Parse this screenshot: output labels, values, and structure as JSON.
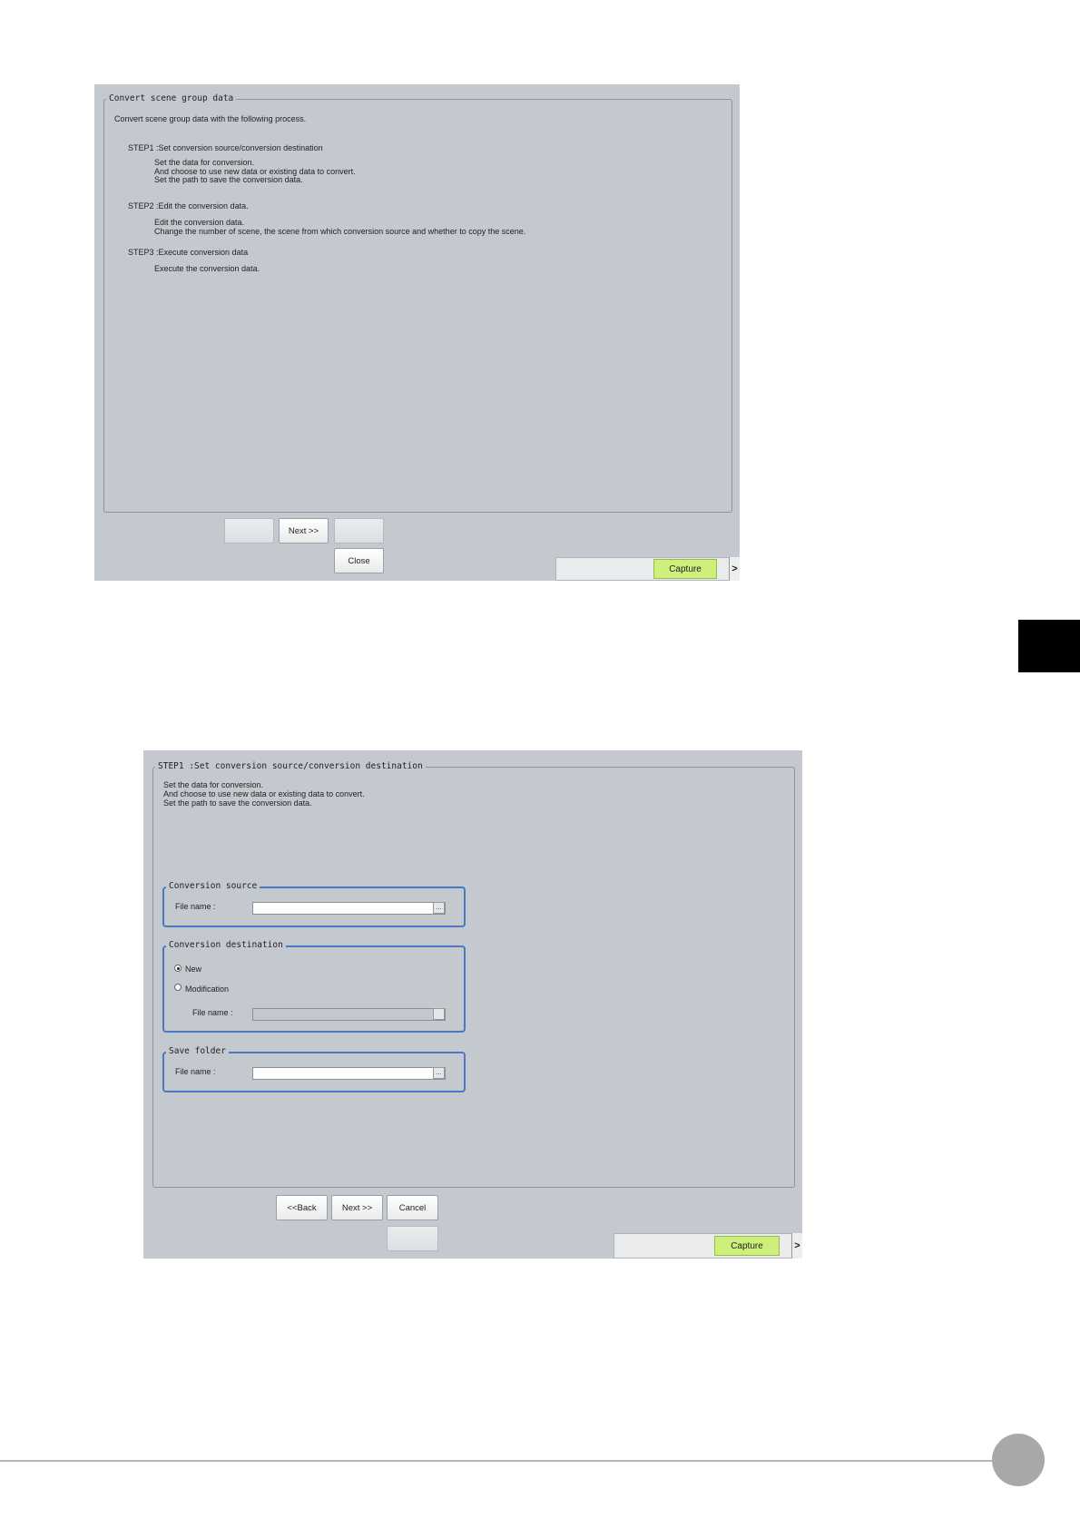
{
  "screen1": {
    "frame_title": "Convert scene group data",
    "intro": "Convert scene group data with the following process.",
    "step1_title": "STEP1 :Set conversion source/conversion destination",
    "step1_lines": [
      "Set the data for conversion.",
      "And choose to use new data or existing data to convert.",
      "Set the path to save the conversion data."
    ],
    "step2_title": "STEP2 :Edit the conversion data.",
    "step2_lines": [
      "Edit the conversion data.",
      "Change the number of scene, the scene from which conversion source and whether to copy the scene."
    ],
    "step3_title": "STEP3 :Execute conversion data",
    "step3_lines": [
      "Execute the conversion data."
    ],
    "buttons": {
      "back": "",
      "next": "Next >>",
      "cancel": "",
      "close": "Close"
    },
    "capture_label": "Capture",
    "arrow_label": ">"
  },
  "screen2": {
    "frame_title": "STEP1 :Set conversion source/conversion destination",
    "desc_lines": [
      "Set the data for conversion.",
      "And choose to use new data or existing data to convert.",
      "Set the path to save the conversion data."
    ],
    "source": {
      "title": "Conversion source",
      "file_label": "File name :",
      "file_value": "",
      "browse": "..."
    },
    "destination": {
      "title": "Conversion destination",
      "option_new": "New",
      "option_modification": "Modification",
      "selected": "New",
      "file_label": "File name :",
      "file_value": ""
    },
    "save_folder": {
      "title": "Save folder",
      "file_label": "File name :",
      "file_value": "",
      "browse": "..."
    },
    "buttons": {
      "back": "<<Back",
      "next": "Next >>",
      "cancel": "Cancel",
      "extra": ""
    },
    "capture_label": "Capture",
    "arrow_label": ">"
  },
  "colors": {
    "screen_bg": "#c4c9cf",
    "group_border": "#4a78c2",
    "capture_bg": "#ccf07a"
  }
}
